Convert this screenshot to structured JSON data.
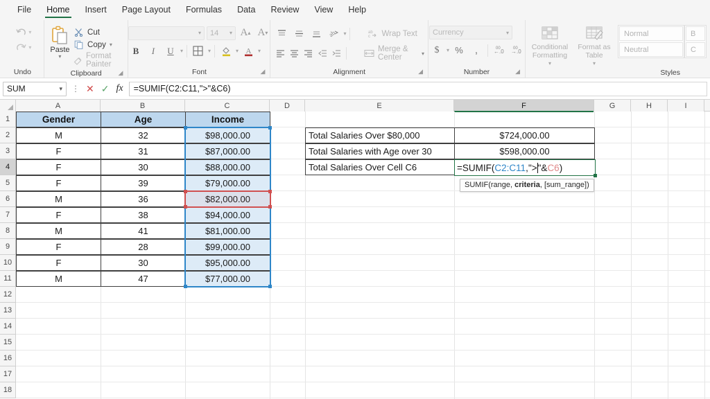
{
  "menu": {
    "items": [
      "File",
      "Home",
      "Insert",
      "Page Layout",
      "Formulas",
      "Data",
      "Review",
      "View",
      "Help"
    ],
    "active": "Home"
  },
  "ribbon": {
    "groups": [
      {
        "label": "Undo"
      },
      {
        "label": "Clipboard"
      },
      {
        "label": "Font"
      },
      {
        "label": "Alignment"
      },
      {
        "label": "Number"
      },
      {
        "label": "Styles"
      }
    ],
    "clipboard": {
      "paste_label": "Paste",
      "cut_label": "Cut",
      "copy_label": "Copy",
      "format_painter_label": "Format Painter"
    },
    "font": {
      "font_name": "",
      "font_size": "14",
      "grow_font": "A",
      "shrink_font": "A",
      "bold": "B",
      "italic": "I",
      "underline": "U"
    },
    "alignment": {
      "wrap_text_label": "Wrap Text",
      "merge_center_label": "Merge & Center"
    },
    "number": {
      "format": "Currency",
      "currency": "$",
      "percent": "%",
      "comma": ",",
      "increase_decimal": ".00",
      "decrease_decimal": ".00"
    },
    "styles": {
      "conditional_formatting_label": "Conditional Formatting",
      "format_as_table_label": "Format as Table",
      "normal_label": "Normal",
      "neutral_label": "Neutral",
      "bad_label": "B",
      "calc_label": "C"
    }
  },
  "formula_bar": {
    "name_box": "SUM",
    "cancel": "✕",
    "enter": "✓",
    "insert_function": "fx",
    "formula": "=SUMIF(C2:C11,\">\"&C6)"
  },
  "sheet": {
    "columns": [
      "A",
      "B",
      "C",
      "D",
      "E",
      "F",
      "G",
      "H",
      "I"
    ],
    "selected_column": "F",
    "rows": [
      1,
      2,
      3,
      4,
      5,
      6,
      7,
      8,
      9,
      10,
      11,
      12,
      13,
      14,
      15,
      16,
      17,
      18
    ],
    "selected_row": 4,
    "table": {
      "headers": [
        "Gender",
        "Age",
        "Income"
      ],
      "rows": [
        [
          "M",
          "32",
          "$98,000.00"
        ],
        [
          "F",
          "31",
          "$87,000.00"
        ],
        [
          "F",
          "30",
          "$88,000.00"
        ],
        [
          "F",
          "39",
          "$79,000.00"
        ],
        [
          "M",
          "36",
          "$82,000.00"
        ],
        [
          "F",
          "38",
          "$94,000.00"
        ],
        [
          "M",
          "41",
          "$81,000.00"
        ],
        [
          "F",
          "28",
          "$99,000.00"
        ],
        [
          "F",
          "30",
          "$95,000.00"
        ],
        [
          "M",
          "47",
          "$77,000.00"
        ]
      ]
    },
    "summary": [
      {
        "label": "Total Salaries Over $80,000",
        "value": "$724,000.00"
      },
      {
        "label": "Total Salaries with Age over 30",
        "value": "$598,000.00"
      },
      {
        "label": "Total Salaries Over Cell C6",
        "value": ""
      }
    ],
    "editing_cell": {
      "address": "F4",
      "prefix": "=SUMIF(",
      "range_ref": "C2:C11",
      "separator": ",",
      "criteria": "\">\"",
      "criteria_open": "\">",
      "criteria_close": "\"",
      "ampersand": "&",
      "cell_ref": "C6",
      "suffix": ")"
    },
    "tooltip": {
      "prefix": "SUMIF(range, ",
      "bold": "criteria",
      "suffix": ", [sum_range])"
    }
  },
  "colors": {
    "accent_green": "#217346",
    "header_fill": "#bdd7ee",
    "money_fill": "#ddebf7",
    "ref_blue": "#2e86c8",
    "ref_red": "#d05050"
  }
}
